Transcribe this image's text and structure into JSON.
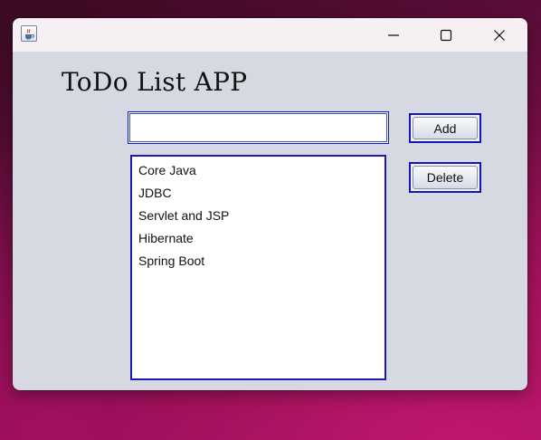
{
  "window": {
    "title": "",
    "app_icon": "java-cup-icon",
    "controls": {
      "minimize_icon": "minimize-icon",
      "maximize_icon": "maximize-icon",
      "close_icon": "close-icon"
    }
  },
  "app": {
    "title": "ToDo List APP",
    "input": {
      "value": "",
      "placeholder": ""
    },
    "buttons": {
      "add_label": "Add",
      "delete_label": "Delete"
    },
    "list": {
      "items": [
        {
          "label": "Core Java"
        },
        {
          "label": "JDBC"
        },
        {
          "label": "Servlet and JSP"
        },
        {
          "label": "Hibernate"
        },
        {
          "label": "Spring Boot"
        }
      ]
    }
  },
  "colors": {
    "window_bg": "#d6d9e1",
    "titlebar_bg": "#f6eff3",
    "focus_border": "#1a1ab0",
    "desktop_accent": "#a3125c"
  }
}
